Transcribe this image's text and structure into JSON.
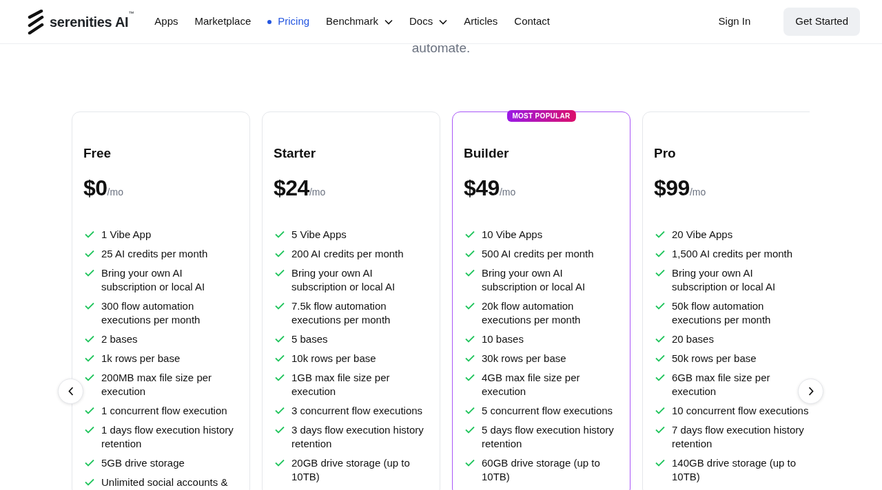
{
  "brand": {
    "name": "serenities AI",
    "trademark": "™"
  },
  "nav": [
    {
      "label": "Apps",
      "kind": "link",
      "selected": false
    },
    {
      "label": "Marketplace",
      "kind": "link",
      "selected": false
    },
    {
      "label": "Pricing",
      "kind": "link",
      "selected": true
    },
    {
      "label": "Benchmark",
      "kind": "dropdown",
      "selected": false
    },
    {
      "label": "Docs",
      "kind": "dropdown",
      "selected": false
    },
    {
      "label": "Articles",
      "kind": "link",
      "selected": false
    },
    {
      "label": "Contact",
      "kind": "link",
      "selected": false
    }
  ],
  "sign_in": "Sign In",
  "get_started": "Get Started",
  "subtitle": "automate.",
  "plans": [
    {
      "name": "Free",
      "price": "$0",
      "period": "/mo",
      "popular": false,
      "features": [
        "1 Vibe App",
        "25 AI credits per month",
        "Bring your own AI subscription or local AI",
        "300 flow automation executions per month",
        "2 bases",
        "1k rows per base",
        "200MB max file size per execution",
        "1 concurrent flow execution",
        "1 days flow execution history retention",
        "5GB drive storage",
        "Unlimited social accounts &"
      ]
    },
    {
      "name": "Starter",
      "price": "$24",
      "period": "/mo",
      "popular": false,
      "features": [
        "5 Vibe Apps",
        "200 AI credits per month",
        "Bring your own AI subscription or local AI",
        "7.5k flow automation executions per month",
        "5 bases",
        "10k rows per base",
        "1GB max file size per execution",
        "3 concurrent flow executions",
        "3 days flow execution history retention",
        "20GB drive storage (up to 10TB)"
      ]
    },
    {
      "name": "Builder",
      "price": "$49",
      "period": "/mo",
      "popular": true,
      "badge": "MOST POPULAR",
      "features": [
        "10 Vibe Apps",
        "500 AI credits per month",
        "Bring your own AI subscription or local AI",
        "20k flow automation executions per month",
        "10 bases",
        "30k rows per base",
        "4GB max file size per execution",
        "5 concurrent flow executions",
        "5 days flow execution history retention",
        "60GB drive storage (up to 10TB)"
      ]
    },
    {
      "name": "Pro",
      "price": "$99",
      "period": "/mo",
      "popular": false,
      "features": [
        "20 Vibe Apps",
        "1,500 AI credits per month",
        "Bring your own AI subscription or local AI",
        "50k flow automation executions per month",
        "20 bases",
        "50k rows per base",
        "6GB max file size per execution",
        "10 concurrent flow executions",
        "7 days flow execution history retention",
        "140GB drive storage (up to 10TB)"
      ]
    }
  ]
}
